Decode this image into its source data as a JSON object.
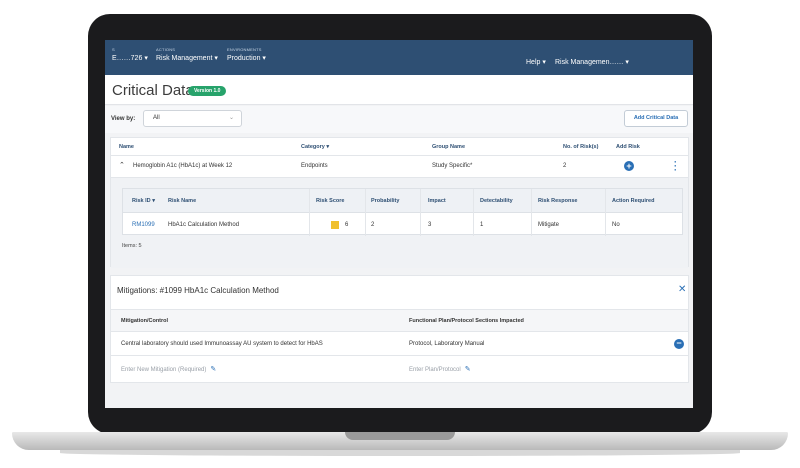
{
  "nav": {
    "study_caption": "S",
    "study_value": "E……726",
    "actions_caption": "ACTIONS",
    "actions_value": "Risk Management",
    "env_caption": "ENVIRONMENTS",
    "env_value": "Production",
    "help": "Help",
    "user_menu": "Risk Managemen……"
  },
  "header": {
    "title": "Critical Data",
    "version_badge": "Version 1.0"
  },
  "viewbar": {
    "label": "View by:",
    "selected": "All",
    "add_button": "Add Critical Data"
  },
  "main_table": {
    "headers": {
      "name": "Name",
      "category": "Category",
      "group": "Group Name",
      "risks": "No. of Risk(s)",
      "add_risk": "Add Risk"
    },
    "row": {
      "name": "Hemoglobin A1c (HbA1c) at Week 12",
      "category": "Endpoints",
      "group": "Study Specific*",
      "risks": "2"
    }
  },
  "risk_table": {
    "headers": {
      "risk_id": "Risk ID",
      "risk_name": "Risk Name",
      "risk_score": "Risk Score",
      "probability": "Probability",
      "impact": "Impact",
      "detectability": "Detectability",
      "response": "Risk Response",
      "action": "Action Required"
    },
    "row": {
      "risk_id": "RM1099",
      "risk_name": "HbA1c Calculation Method",
      "risk_score": "6",
      "probability": "2",
      "impact": "3",
      "detectability": "1",
      "response": "Mitigate",
      "action": "No"
    },
    "items": "Items: 5"
  },
  "mitigations": {
    "title": "Mitigations: #1099 HbA1c Calculation Method",
    "headers": {
      "control": "Mitigation/Control",
      "sections": "Functional Plan/Protocol Sections Impacted"
    },
    "row": {
      "control": "Central laboratory should used Immunoassay AU system to detect for HbAS",
      "sections": "Protocol, Laboratory Manual"
    },
    "new_row": {
      "control_placeholder": "Enter New Mitigation (Required)",
      "sections_placeholder": "Enter Plan/Protocol"
    }
  },
  "colors": {
    "nav_bg": "#2e4f73",
    "accent": "#2a6fb5",
    "badge_green": "#27a36b",
    "score_yellow": "#f0c02e"
  }
}
